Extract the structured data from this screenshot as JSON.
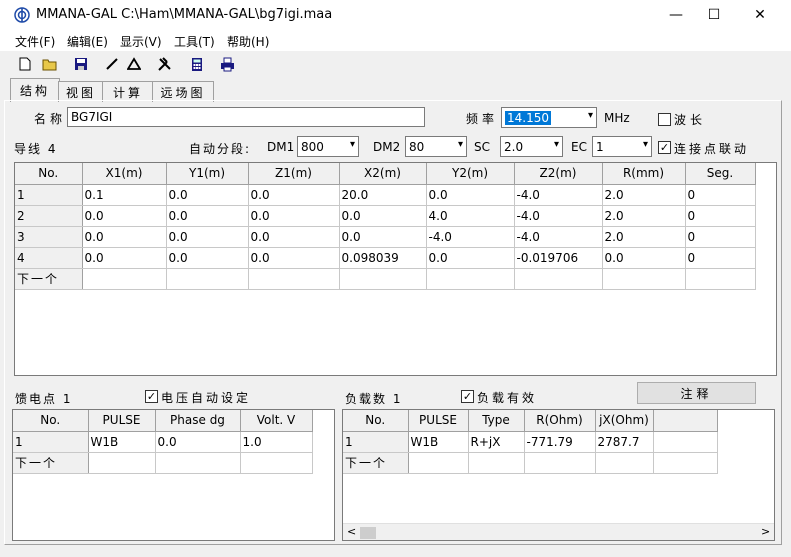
{
  "window": {
    "title": "MMANA-GAL C:\\Ham\\MMANA-GAL\\bg7igi.maa",
    "minimize": "—",
    "maximize": "☐",
    "close": "✕"
  },
  "menu": [
    "文件(F)",
    "编辑(E)",
    "显示(V)",
    "工具(T)",
    "帮助(H)"
  ],
  "toolbar_icons": [
    "new-file-icon",
    "open-folder-icon",
    "save-icon",
    "line-tool-icon",
    "triangle-icon",
    "tools-icon",
    "calculator-icon",
    "printer-icon"
  ],
  "tabs": [
    "结构",
    "视图",
    "计算",
    "远场图"
  ],
  "geometry": {
    "name_label": "名称",
    "name_value": "BG7IGI",
    "freq_label": "频率",
    "freq_value": "14.150",
    "freq_unit": "MHz",
    "wavelength_label": "波长",
    "wavelength_checked": false,
    "wires_label": "导线 4",
    "autoseg_label": "自动分段:",
    "dm1_label": "DM1",
    "dm1_value": "800",
    "dm2_label": "DM2",
    "dm2_value": "80",
    "sc_label": "SC",
    "sc_value": "2.0",
    "ec_label": "EC",
    "ec_value": "1",
    "link_label": "连接点联动",
    "link_checked": true
  },
  "wires_table": {
    "headers": [
      "No.",
      "X1(m)",
      "Y1(m)",
      "Z1(m)",
      "X2(m)",
      "Y2(m)",
      "Z2(m)",
      "R(mm)",
      "Seg."
    ],
    "rows": [
      [
        "1",
        "0.1",
        "0.0",
        "0.0",
        "20.0",
        "0.0",
        "-4.0",
        "2.0",
        "0"
      ],
      [
        "2",
        "0.0",
        "0.0",
        "0.0",
        "0.0",
        "4.0",
        "-4.0",
        "2.0",
        "0"
      ],
      [
        "3",
        "0.0",
        "0.0",
        "0.0",
        "0.0",
        "-4.0",
        "-4.0",
        "2.0",
        "0"
      ],
      [
        "4",
        "0.0",
        "0.0",
        "0.0",
        "0.098039",
        "0.0",
        "-0.019706",
        "0.0",
        "0"
      ]
    ],
    "next_label": "下一个"
  },
  "sources": {
    "label": "馈电点 1",
    "auto_label": "电压自动设定",
    "auto_checked": true,
    "headers": [
      "No.",
      "PULSE",
      "Phase dg",
      "Volt. V"
    ],
    "rows": [
      [
        "1",
        "W1B",
        "0.0",
        "1.0"
      ]
    ],
    "next_label": "下一个"
  },
  "loads": {
    "label": "负载数 1",
    "enabled_label": "负载有效",
    "enabled_checked": true,
    "comment_button": "注释",
    "headers": [
      "No.",
      "PULSE",
      "Type",
      "R(Ohm)",
      "jX(Ohm)",
      ""
    ],
    "rows": [
      [
        "1",
        "W1B",
        "R+jX",
        "-771.79",
        "2787.7",
        ""
      ]
    ],
    "next_label": "下一个",
    "scroll_left": "<",
    "scroll_right": ">"
  }
}
